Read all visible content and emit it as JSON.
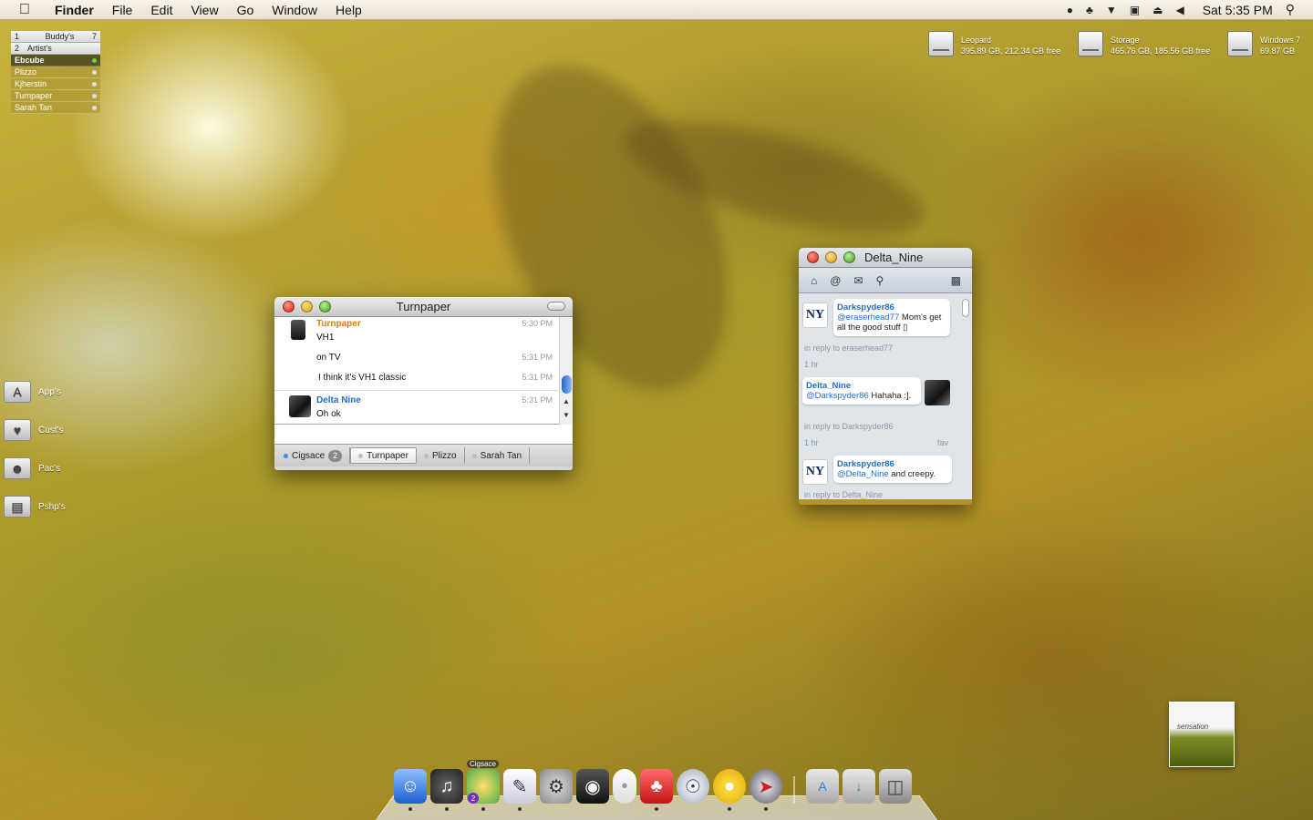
{
  "menubar": {
    "app_name": "Finder",
    "items": [
      "File",
      "Edit",
      "View",
      "Go",
      "Window",
      "Help"
    ],
    "clock": "Sat 5:35 PM"
  },
  "buddy_list": {
    "groups": [
      {
        "num": "1",
        "name": "Buddy's",
        "count": "7"
      },
      {
        "num": "2",
        "name": "Artist's",
        "count": ""
      }
    ],
    "buddies": [
      "Ebcube",
      "Plizzo",
      "Kjherstin",
      "Turnpaper",
      "Sarah Tan"
    ]
  },
  "drives": [
    {
      "name": "Leopard",
      "info": "395.89 GB, 212.34 GB free"
    },
    {
      "name": "Storage",
      "info": "465.76 GB, 185.56 GB free"
    },
    {
      "name": "Windows 7",
      "info": "69.87 GB"
    }
  ],
  "stacks": [
    "App's",
    "Cust's",
    "Pac's",
    "Pshp's"
  ],
  "chat": {
    "title": "Turnpaper",
    "messages": [
      {
        "sender": "Turnpaper",
        "text": "VH1",
        "time": "5:30 PM"
      },
      {
        "sender": "",
        "text": "on TV",
        "time": "5:31 PM"
      },
      {
        "sender": "",
        "text": "I think it's VH1 classic",
        "time": "5:31 PM"
      },
      {
        "sender": "Delta Nine",
        "text": "Oh ok",
        "time": "5:31 PM"
      }
    ],
    "tabs": [
      {
        "label": "Cigsace",
        "badge": "2"
      },
      {
        "label": "Turnpaper"
      },
      {
        "label": "Plizzo"
      },
      {
        "label": "Sarah Tan"
      }
    ]
  },
  "twitter": {
    "title": "Delta_Nine",
    "tweets": [
      {
        "user": "Darkspyder86",
        "mention": "@eraserhead77",
        "text": " Mom's get all the good stuff ▯",
        "reply": "in reply to eraserhead77",
        "time": "1 hr",
        "fav": ""
      },
      {
        "user": "Delta_Nine",
        "mention": "@Darkspyder86",
        "text": " Hahaha :].",
        "reply": "in reply to Darkspyder86",
        "time": "1 hr",
        "fav": "fav"
      },
      {
        "user": "Darkspyder86",
        "mention": "@Delta_Nine",
        "text": " and creepy.",
        "reply": "in reply to Delta_Nine",
        "time": "",
        "fav": ""
      }
    ]
  },
  "dock": {
    "tooltip": "Cigsace",
    "badge": "2",
    "icons": [
      "finder-icon",
      "headphones-icon",
      "adium-icon",
      "textedit-icon",
      "system-preferences-icon",
      "camera-icon",
      "mouse-icon",
      "flashcards-icon",
      "dvd-icon",
      "duck-icon",
      "safari-icon",
      "applications-folder-icon",
      "downloads-folder-icon",
      "trash-icon"
    ]
  },
  "album": {
    "text": "sensation"
  },
  "colors": {
    "accent_orange": "#e37c00",
    "link_blue": "#1f6fcf"
  }
}
